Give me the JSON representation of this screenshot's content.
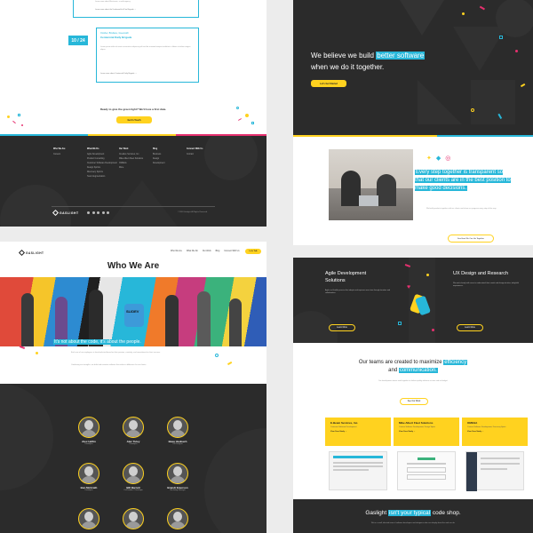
{
  "top_left": {
    "prev_item_link": "Learn more about Electromic, a multi-agency",
    "item_link": "Learn more about the Underworld of Fire Brigade →",
    "date": "10 / 24",
    "item_date": "October, Brisbane, Greenwich",
    "item_title": "Centennial Daily Brigade",
    "item_body": "Lorem ipsum dolor sit amet consectetur adipiscing elit sed do eiusmod tempor incididunt ut labore et dolore magna aliqua.",
    "item_link2": "Learn more about Centennial Daily Brigade →",
    "cta_text": "Ready to give the green light? We'd love a first date.",
    "cta_button": "Get In Touch",
    "footer_cols": [
      {
        "heading": "Who We Are",
        "items": [
          "Careers"
        ]
      },
      {
        "heading": "What We Do",
        "items": [
          "Agile Development",
          "Product Consulting",
          "Customer Software Development",
          "Design Sprints",
          "Discovery Sprints",
          "Team Augmentation"
        ]
      },
      {
        "heading": "Our Work",
        "items": [
          "Creative Services, Inc.",
          "Mike Albert Fleet Solutions",
          "OMEGA",
          "More"
        ]
      },
      {
        "heading": "Blog",
        "items": [
          "Business",
          "Design",
          "Development"
        ]
      },
      {
        "heading": "Connect With Us",
        "items": [
          "Contact"
        ]
      }
    ],
    "footer_logo": "GASLIGHT",
    "footer_copy": "© 2018 Gaslight. All Rights Reserved."
  },
  "who_we_are": {
    "logo": "GASLIGHT",
    "nav": [
      "Who We Are",
      "What We Do",
      "Our Work",
      "Blog",
      "Connect With Us"
    ],
    "nav_cta": "Let's Talk",
    "title": "Who We Are",
    "caption": "It's not about the code, it's about the people.",
    "jersey": "SLIDEV",
    "para1": "Each one of our employees is hand-selected based on their passion, creativity, and commitment to client success.",
    "para2": "Combining our strengths, we build and maintain software that makes a difference for our clients.",
    "team": [
      {
        "name": "Alex Heftin",
        "role": "Developer"
      },
      {
        "name": "Alec Tuley",
        "role": "Developer"
      },
      {
        "name": "Beau Heubach",
        "role": "UX Designer"
      },
      {
        "name": "Ben McGrath",
        "role": "Developer"
      },
      {
        "name": "Bill Barrett",
        "role": "Co-Founder / Developer"
      },
      {
        "name": "Brandi Emerson",
        "role": "Marketing Manager"
      }
    ]
  },
  "hero": {
    "line1_plain": "We believe we build",
    "line1_hl": "better software",
    "line2": "when we do it together.",
    "button": "Let's Get Started"
  },
  "together": {
    "hl": "Every step together is transparent so that our clients are in the best position to make good decisions.",
    "body": "We build products together with our clients and share our progress every step of the way.",
    "button": "See How We Can Go Together"
  },
  "services": {
    "left_title": "Agile Development Solutions",
    "left_body": "Agile is a flexible process that adapts and improves over time through iteration and collaboration.",
    "left_button": "Learn More",
    "right_title": "UX Design and Research",
    "right_body": "We work closely with users to understand their needs and design intuitive, delightful experiences.",
    "right_button": "Learn More"
  },
  "maximize": {
    "title_plain": "Our teams are created to maximize",
    "title_hl1": "efficiency",
    "title_mid": "and",
    "title_hl2": "communication.",
    "body": "Our development teams work together to deliver quality software on time and on budget.",
    "button": "See Our Work",
    "cards": [
      {
        "title": "E-Beam Services, Inc.",
        "sub": "Customer Software Development",
        "link": "View Case Study →"
      },
      {
        "title": "Mike Albert Fleet Solutions",
        "sub": "Custom Software Development, Design Sprint",
        "link": "View Case Study →"
      },
      {
        "title": "OMEGA",
        "sub": "Custom Software Development, Discovery Sprint",
        "link": "View Case Study →"
      }
    ]
  },
  "code_shop": {
    "plain1": "Gaslight",
    "hl": "isn't your typical",
    "plain2": "code shop.",
    "body": "We're a small, talented team of software developers and designers who care deeply about the work we do."
  },
  "colors": {
    "accent_yellow": "#ffd21f",
    "accent_blue": "#27b7d9",
    "dark_bg": "#2b2b2b"
  }
}
